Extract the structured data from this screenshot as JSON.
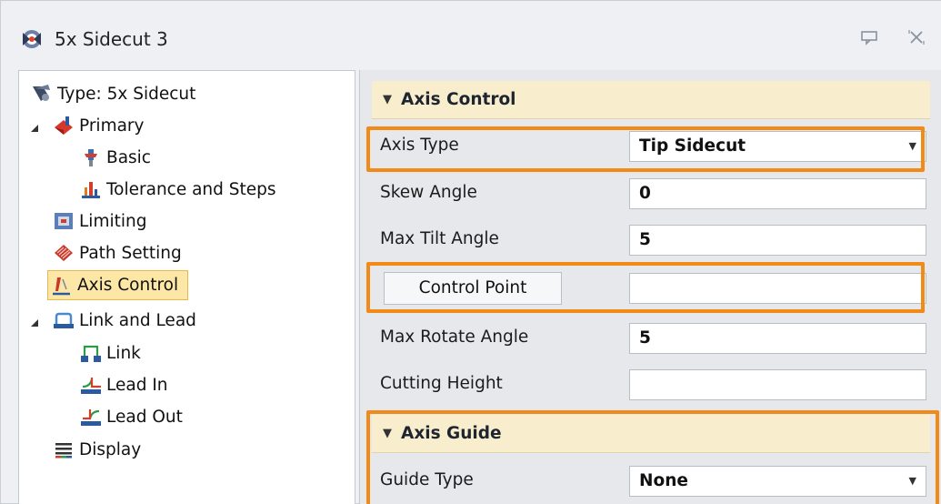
{
  "window": {
    "title": "5x Sidecut 3",
    "icons": {
      "app": "toolpath-app-icon",
      "pin": "pin-icon",
      "close": "close-icon"
    }
  },
  "tree": {
    "items": [
      {
        "label": "Type: 5x Sidecut",
        "icon": "operation-type-icon"
      },
      {
        "label": "Primary",
        "icon": "primary-icon",
        "expanded": true
      },
      {
        "label": "Basic",
        "icon": "basic-icon"
      },
      {
        "label": "Tolerance and Steps",
        "icon": "tolerance-icon"
      },
      {
        "label": "Limiting",
        "icon": "limiting-icon"
      },
      {
        "label": "Path Setting",
        "icon": "path-setting-icon"
      },
      {
        "label": "Axis Control",
        "icon": "axis-control-icon",
        "selected": true
      },
      {
        "label": "Link and Lead",
        "icon": "link-lead-icon",
        "expanded": true
      },
      {
        "label": "Link",
        "icon": "link-icon"
      },
      {
        "label": "Lead In",
        "icon": "lead-in-icon"
      },
      {
        "label": "Lead Out",
        "icon": "lead-out-icon"
      },
      {
        "label": "Display",
        "icon": "display-icon"
      }
    ]
  },
  "props": {
    "axis_control": {
      "header": "Axis Control",
      "rows": [
        {
          "label": "Axis Type",
          "value": "Tip Sidecut",
          "type": "dropdown"
        },
        {
          "label": "Skew Angle",
          "value": "0",
          "type": "input"
        },
        {
          "label": "Max Tilt Angle",
          "value": "5",
          "type": "input"
        },
        {
          "label": "Control Point",
          "value": "",
          "type": "button-input"
        },
        {
          "label": "Max Rotate Angle",
          "value": "5",
          "type": "input"
        },
        {
          "label": "Cutting Height",
          "value": "",
          "type": "input"
        }
      ]
    },
    "axis_guide": {
      "header": "Axis Guide",
      "rows": [
        {
          "label": "Guide Type",
          "value": "None",
          "type": "dropdown"
        }
      ]
    }
  },
  "colors": {
    "highlight": "#f28a17",
    "section_header_bg": "#f8eecd",
    "selected_bg": "#fde7a6"
  }
}
